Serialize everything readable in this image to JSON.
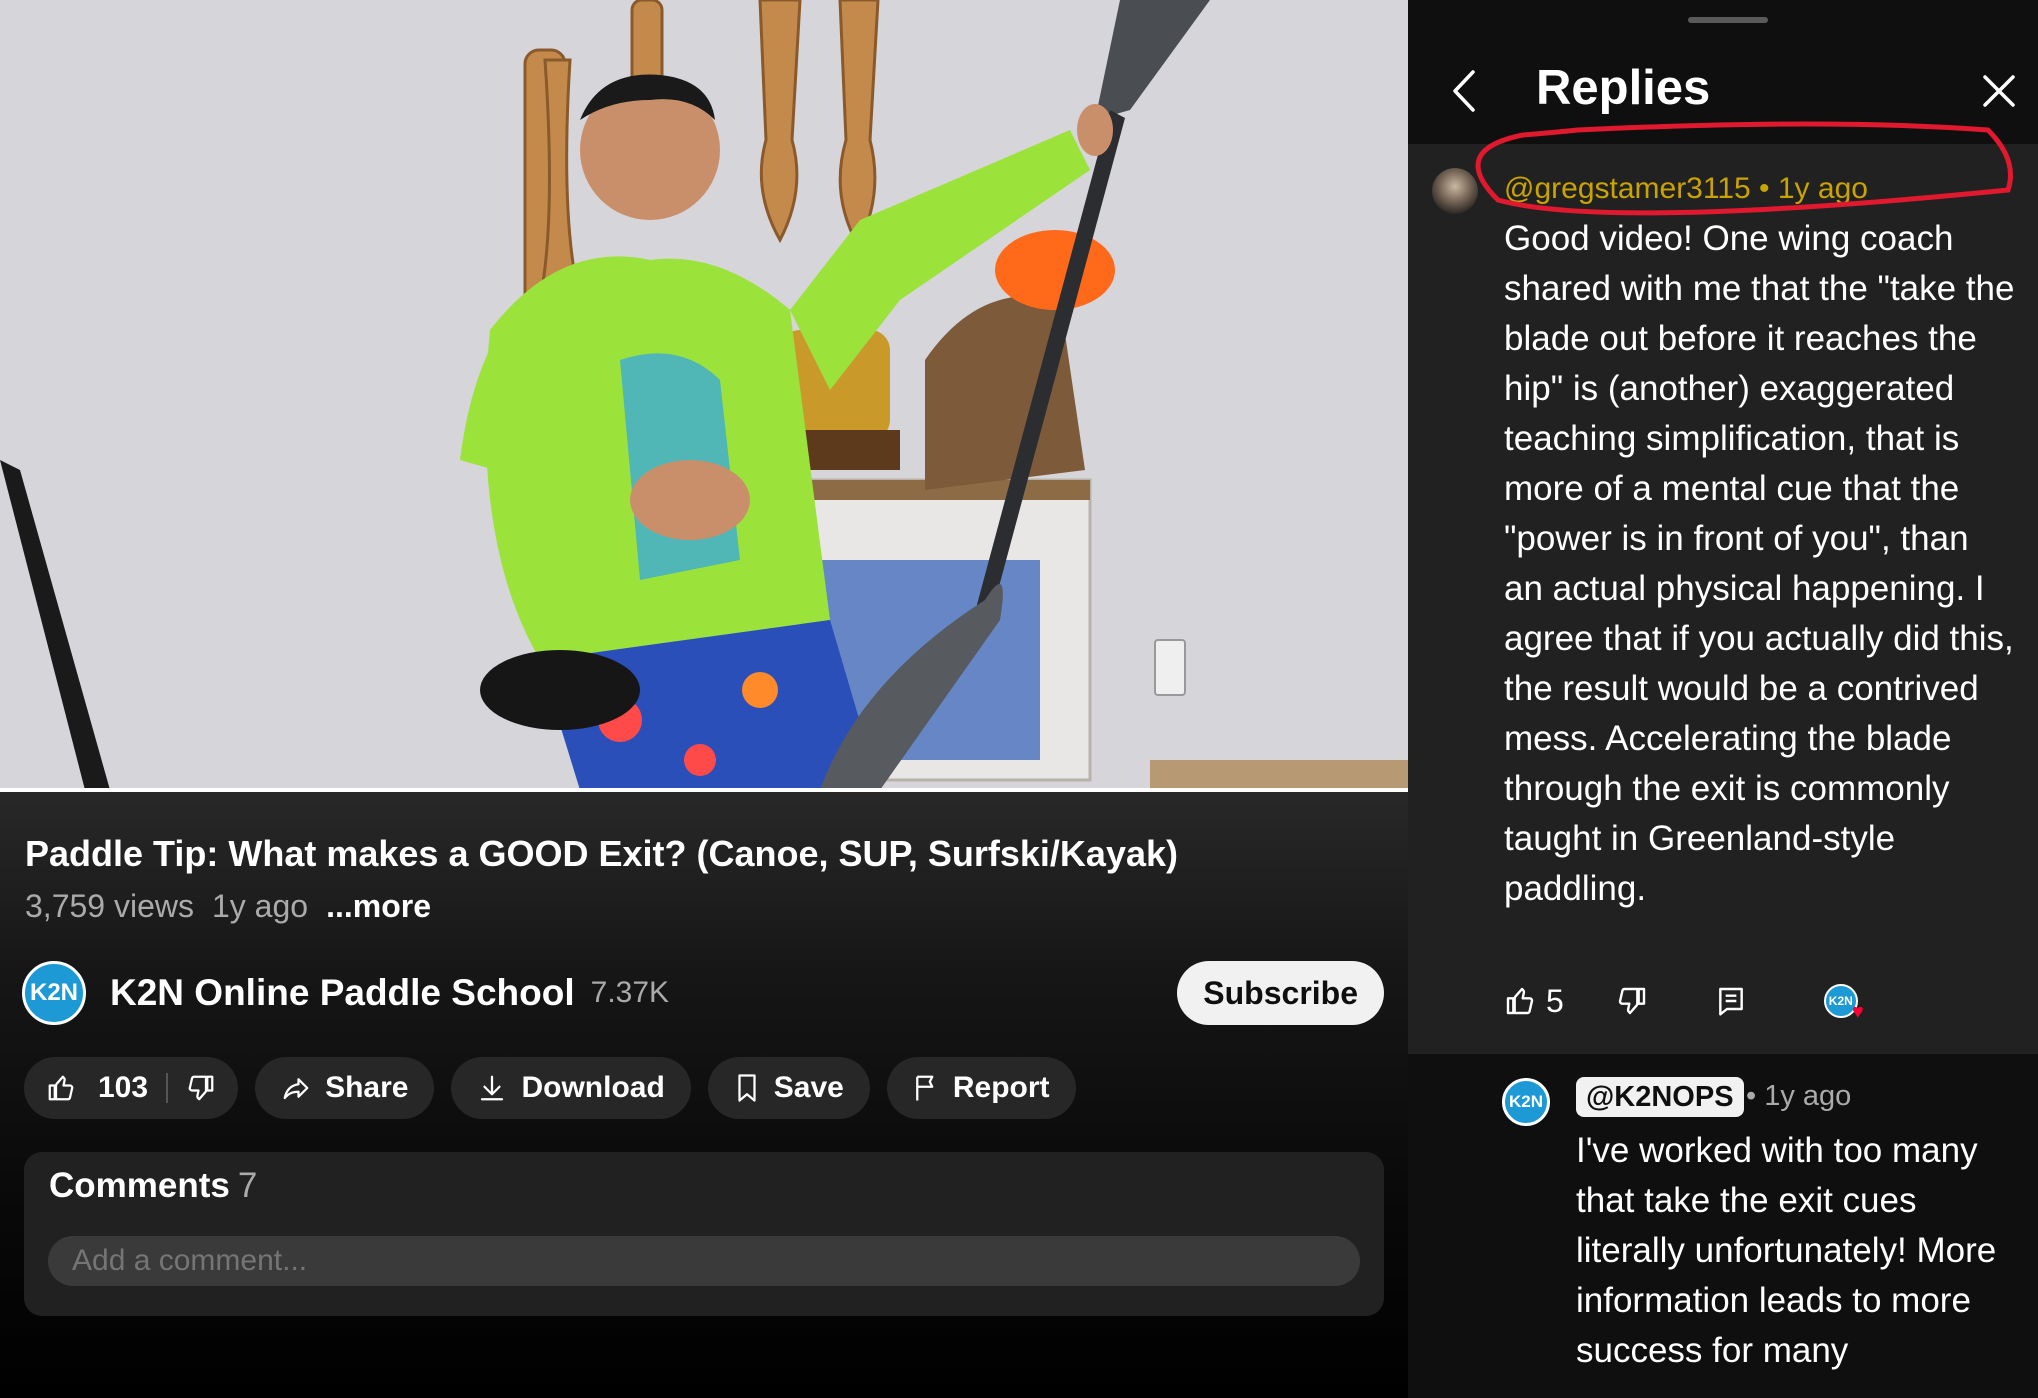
{
  "video": {
    "title": "Paddle Tip: What makes a GOOD Exit? (Canoe, SUP, Surfski/Kayak)",
    "views": "3,759 views",
    "age": "1y ago",
    "more_label": "...more",
    "progress": 1.0
  },
  "channel": {
    "avatar_text": "K2N",
    "name": "K2N Online Paddle School",
    "subscribers": "7.37K",
    "subscribe_label": "Subscribe"
  },
  "actions": {
    "like_count": "103",
    "share_label": "Share",
    "download_label": "Download",
    "save_label": "Save",
    "report_label": "Report"
  },
  "comments": {
    "heading": "Comments",
    "count": "7",
    "placeholder": "Add a comment..."
  },
  "replies_panel": {
    "title": "Replies",
    "parent": {
      "author_line": "@gregstamer3115 • 1y ago",
      "text": "Good video! One wing coach shared with me that the \"take the blade out before it reaches the hip\" is (another) exaggerated teaching simplification, that is more of a mental cue that the \"power is in front of you\", than an actual physical happening. I agree that if you actually did this, the result would be a contrived mess. Accelerating the blade through the exit is commonly taught in Greenland-style paddling.",
      "like_count": "5",
      "creator_heart_avatar": "K2N"
    },
    "reply": {
      "avatar_text": "K2N",
      "author": "@K2NOPS",
      "time": "• 1y ago",
      "text": "I've worked with too many that take the exit cues literally unfortunately! More information leads to more success for many"
    }
  },
  "colors": {
    "author_highlight": "#c9a300",
    "annotation_circle": "#e0192e",
    "channel_avatar": "#1d9ad6"
  }
}
